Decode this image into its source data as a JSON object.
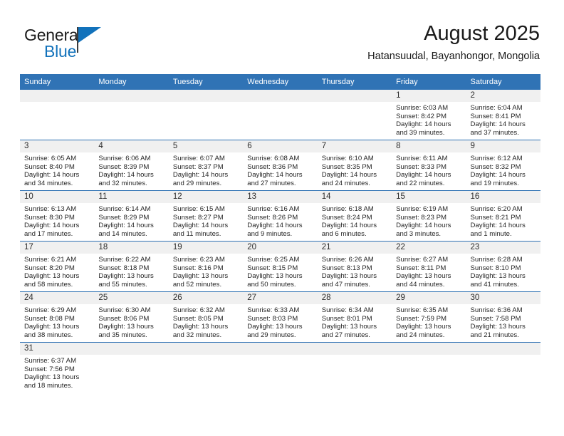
{
  "brand": {
    "name_part1": "General",
    "name_part2": "Blue",
    "flag_icon": "blue-triangle-flag-icon",
    "accent_color": "#1272bb"
  },
  "header": {
    "title": "August 2025",
    "subtitle": "Hatansuudal, Bayanhongor, Mongolia"
  },
  "theme": {
    "header_blue": "#3073b5",
    "row_divider_blue": "#2f72b3",
    "daynum_band_gray": "#f0f0f0"
  },
  "calendar": {
    "weekday_headers": [
      "Sunday",
      "Monday",
      "Tuesday",
      "Wednesday",
      "Thursday",
      "Friday",
      "Saturday"
    ],
    "weeks": [
      [
        {
          "day": "",
          "lines": []
        },
        {
          "day": "",
          "lines": []
        },
        {
          "day": "",
          "lines": []
        },
        {
          "day": "",
          "lines": []
        },
        {
          "day": "",
          "lines": []
        },
        {
          "day": "1",
          "lines": [
            "Sunrise: 6:03 AM",
            "Sunset: 8:42 PM",
            "Daylight: 14 hours",
            "and 39 minutes."
          ]
        },
        {
          "day": "2",
          "lines": [
            "Sunrise: 6:04 AM",
            "Sunset: 8:41 PM",
            "Daylight: 14 hours",
            "and 37 minutes."
          ]
        }
      ],
      [
        {
          "day": "3",
          "lines": [
            "Sunrise: 6:05 AM",
            "Sunset: 8:40 PM",
            "Daylight: 14 hours",
            "and 34 minutes."
          ]
        },
        {
          "day": "4",
          "lines": [
            "Sunrise: 6:06 AM",
            "Sunset: 8:39 PM",
            "Daylight: 14 hours",
            "and 32 minutes."
          ]
        },
        {
          "day": "5",
          "lines": [
            "Sunrise: 6:07 AM",
            "Sunset: 8:37 PM",
            "Daylight: 14 hours",
            "and 29 minutes."
          ]
        },
        {
          "day": "6",
          "lines": [
            "Sunrise: 6:08 AM",
            "Sunset: 8:36 PM",
            "Daylight: 14 hours",
            "and 27 minutes."
          ]
        },
        {
          "day": "7",
          "lines": [
            "Sunrise: 6:10 AM",
            "Sunset: 8:35 PM",
            "Daylight: 14 hours",
            "and 24 minutes."
          ]
        },
        {
          "day": "8",
          "lines": [
            "Sunrise: 6:11 AM",
            "Sunset: 8:33 PM",
            "Daylight: 14 hours",
            "and 22 minutes."
          ]
        },
        {
          "day": "9",
          "lines": [
            "Sunrise: 6:12 AM",
            "Sunset: 8:32 PM",
            "Daylight: 14 hours",
            "and 19 minutes."
          ]
        }
      ],
      [
        {
          "day": "10",
          "lines": [
            "Sunrise: 6:13 AM",
            "Sunset: 8:30 PM",
            "Daylight: 14 hours",
            "and 17 minutes."
          ]
        },
        {
          "day": "11",
          "lines": [
            "Sunrise: 6:14 AM",
            "Sunset: 8:29 PM",
            "Daylight: 14 hours",
            "and 14 minutes."
          ]
        },
        {
          "day": "12",
          "lines": [
            "Sunrise: 6:15 AM",
            "Sunset: 8:27 PM",
            "Daylight: 14 hours",
            "and 11 minutes."
          ]
        },
        {
          "day": "13",
          "lines": [
            "Sunrise: 6:16 AM",
            "Sunset: 8:26 PM",
            "Daylight: 14 hours",
            "and 9 minutes."
          ]
        },
        {
          "day": "14",
          "lines": [
            "Sunrise: 6:18 AM",
            "Sunset: 8:24 PM",
            "Daylight: 14 hours",
            "and 6 minutes."
          ]
        },
        {
          "day": "15",
          "lines": [
            "Sunrise: 6:19 AM",
            "Sunset: 8:23 PM",
            "Daylight: 14 hours",
            "and 3 minutes."
          ]
        },
        {
          "day": "16",
          "lines": [
            "Sunrise: 6:20 AM",
            "Sunset: 8:21 PM",
            "Daylight: 14 hours",
            "and 1 minute."
          ]
        }
      ],
      [
        {
          "day": "17",
          "lines": [
            "Sunrise: 6:21 AM",
            "Sunset: 8:20 PM",
            "Daylight: 13 hours",
            "and 58 minutes."
          ]
        },
        {
          "day": "18",
          "lines": [
            "Sunrise: 6:22 AM",
            "Sunset: 8:18 PM",
            "Daylight: 13 hours",
            "and 55 minutes."
          ]
        },
        {
          "day": "19",
          "lines": [
            "Sunrise: 6:23 AM",
            "Sunset: 8:16 PM",
            "Daylight: 13 hours",
            "and 52 minutes."
          ]
        },
        {
          "day": "20",
          "lines": [
            "Sunrise: 6:25 AM",
            "Sunset: 8:15 PM",
            "Daylight: 13 hours",
            "and 50 minutes."
          ]
        },
        {
          "day": "21",
          "lines": [
            "Sunrise: 6:26 AM",
            "Sunset: 8:13 PM",
            "Daylight: 13 hours",
            "and 47 minutes."
          ]
        },
        {
          "day": "22",
          "lines": [
            "Sunrise: 6:27 AM",
            "Sunset: 8:11 PM",
            "Daylight: 13 hours",
            "and 44 minutes."
          ]
        },
        {
          "day": "23",
          "lines": [
            "Sunrise: 6:28 AM",
            "Sunset: 8:10 PM",
            "Daylight: 13 hours",
            "and 41 minutes."
          ]
        }
      ],
      [
        {
          "day": "24",
          "lines": [
            "Sunrise: 6:29 AM",
            "Sunset: 8:08 PM",
            "Daylight: 13 hours",
            "and 38 minutes."
          ]
        },
        {
          "day": "25",
          "lines": [
            "Sunrise: 6:30 AM",
            "Sunset: 8:06 PM",
            "Daylight: 13 hours",
            "and 35 minutes."
          ]
        },
        {
          "day": "26",
          "lines": [
            "Sunrise: 6:32 AM",
            "Sunset: 8:05 PM",
            "Daylight: 13 hours",
            "and 32 minutes."
          ]
        },
        {
          "day": "27",
          "lines": [
            "Sunrise: 6:33 AM",
            "Sunset: 8:03 PM",
            "Daylight: 13 hours",
            "and 29 minutes."
          ]
        },
        {
          "day": "28",
          "lines": [
            "Sunrise: 6:34 AM",
            "Sunset: 8:01 PM",
            "Daylight: 13 hours",
            "and 27 minutes."
          ]
        },
        {
          "day": "29",
          "lines": [
            "Sunrise: 6:35 AM",
            "Sunset: 7:59 PM",
            "Daylight: 13 hours",
            "and 24 minutes."
          ]
        },
        {
          "day": "30",
          "lines": [
            "Sunrise: 6:36 AM",
            "Sunset: 7:58 PM",
            "Daylight: 13 hours",
            "and 21 minutes."
          ]
        }
      ],
      [
        {
          "day": "31",
          "lines": [
            "Sunrise: 6:37 AM",
            "Sunset: 7:56 PM",
            "Daylight: 13 hours",
            "and 18 minutes."
          ]
        },
        {
          "day": "",
          "lines": []
        },
        {
          "day": "",
          "lines": []
        },
        {
          "day": "",
          "lines": []
        },
        {
          "day": "",
          "lines": []
        },
        {
          "day": "",
          "lines": []
        },
        {
          "day": "",
          "lines": []
        }
      ]
    ]
  }
}
